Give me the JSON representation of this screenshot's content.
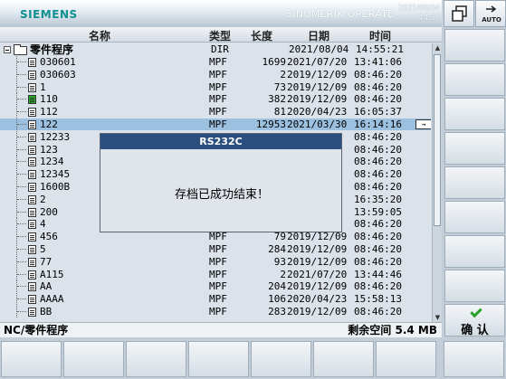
{
  "header": {
    "brand": "SIEMENS",
    "product": "SINUMERIK OPERATE",
    "clock_date": "2021/08/04",
    "clock_time": "14:56",
    "auto_label": "AUTO"
  },
  "columns": {
    "name": "名称",
    "type": "类型",
    "length": "长度",
    "date": "日期",
    "time": "时间"
  },
  "root": {
    "label": "零件程序",
    "type": "DIR",
    "date": "2021/08/04",
    "time": "14:55:21"
  },
  "files": [
    {
      "name": "030601",
      "type": "MPF",
      "length": "1699",
      "date": "2021/07/20",
      "time": "13:41:06",
      "icon": "doc"
    },
    {
      "name": "030603",
      "type": "MPF",
      "length": "2",
      "date": "2019/12/09",
      "time": "08:46:20",
      "icon": "doc"
    },
    {
      "name": "1",
      "type": "MPF",
      "length": "73",
      "date": "2019/12/09",
      "time": "08:46:20",
      "icon": "doc"
    },
    {
      "name": "110",
      "type": "MPF",
      "length": "382",
      "date": "2019/12/09",
      "time": "08:46:20",
      "icon": "green"
    },
    {
      "name": "112",
      "type": "MPF",
      "length": "81",
      "date": "2020/04/23",
      "time": "16:05:37",
      "icon": "doc"
    },
    {
      "name": "122",
      "type": "MPF",
      "length": "12953",
      "date": "2021/03/30",
      "time": "16:14:16",
      "icon": "doc",
      "selected": true
    },
    {
      "name": "12233",
      "type": "",
      "length": "",
      "date": "9",
      "time": "08:46:20",
      "icon": "doc"
    },
    {
      "name": "123",
      "type": "",
      "length": "",
      "date": "9",
      "time": "08:46:20",
      "icon": "doc"
    },
    {
      "name": "1234",
      "type": "",
      "length": "",
      "date": "9",
      "time": "08:46:20",
      "icon": "doc"
    },
    {
      "name": "12345",
      "type": "",
      "length": "",
      "date": "9",
      "time": "08:46:20",
      "icon": "doc"
    },
    {
      "name": "1600B",
      "type": "",
      "length": "",
      "date": "9",
      "time": "08:46:20",
      "icon": "doc"
    },
    {
      "name": "2",
      "type": "",
      "length": "",
      "date": "3",
      "time": "16:35:20",
      "icon": "doc"
    },
    {
      "name": "200",
      "type": "",
      "length": "",
      "date": "0",
      "time": "13:59:05",
      "icon": "doc"
    },
    {
      "name": "4",
      "type": "",
      "length": "",
      "date": "9",
      "time": "08:46:20",
      "icon": "doc"
    },
    {
      "name": "456",
      "type": "MPF",
      "length": "79",
      "date": "2019/12/09",
      "time": "08:46:20",
      "icon": "doc"
    },
    {
      "name": "5",
      "type": "MPF",
      "length": "284",
      "date": "2019/12/09",
      "time": "08:46:20",
      "icon": "doc"
    },
    {
      "name": "77",
      "type": "MPF",
      "length": "93",
      "date": "2019/12/09",
      "time": "08:46:20",
      "icon": "doc"
    },
    {
      "name": "A115",
      "type": "MPF",
      "length": "2",
      "date": "2021/07/20",
      "time": "13:44:46",
      "icon": "doc"
    },
    {
      "name": "AA",
      "type": "MPF",
      "length": "204",
      "date": "2019/12/09",
      "time": "08:46:20",
      "icon": "doc"
    },
    {
      "name": "AAAA",
      "type": "MPF",
      "length": "106",
      "date": "2020/04/23",
      "time": "15:58:13",
      "icon": "doc"
    },
    {
      "name": "BB",
      "type": "MPF",
      "length": "283",
      "date": "2019/12/09",
      "time": "08:46:20",
      "icon": "doc"
    }
  ],
  "dialog": {
    "title": "RS232C",
    "message": "存档已成功结束！"
  },
  "status": {
    "path": "NC/零件程序",
    "free": "剩余空间 5.4 MB"
  },
  "softkeys": {
    "ok_label": "确 认"
  }
}
